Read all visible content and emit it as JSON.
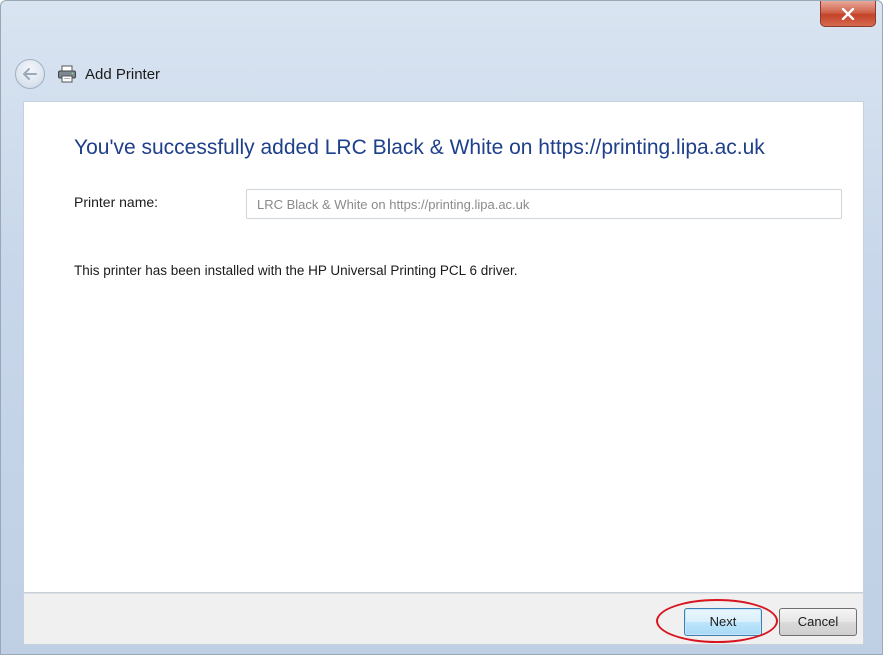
{
  "window": {
    "title": "Add Printer",
    "close_glyph": "x"
  },
  "icons": {
    "back": "back-arrow-icon",
    "printer": "printer-icon",
    "close": "close-icon"
  },
  "main": {
    "heading": "You've successfully added LRC Black & White on https://printing.lipa.ac.uk",
    "printer_name_label": "Printer name:",
    "printer_name_value": "LRC Black & White on https://printing.lipa.ac.uk",
    "driver_message": "This printer has been installed with the HP Universal Printing PCL 6 driver."
  },
  "footer": {
    "next_label": "Next",
    "cancel_label": "Cancel"
  },
  "colors": {
    "heading": "#1e3f8a",
    "highlight_ring": "#d8141e",
    "close_button": "#c44327"
  }
}
